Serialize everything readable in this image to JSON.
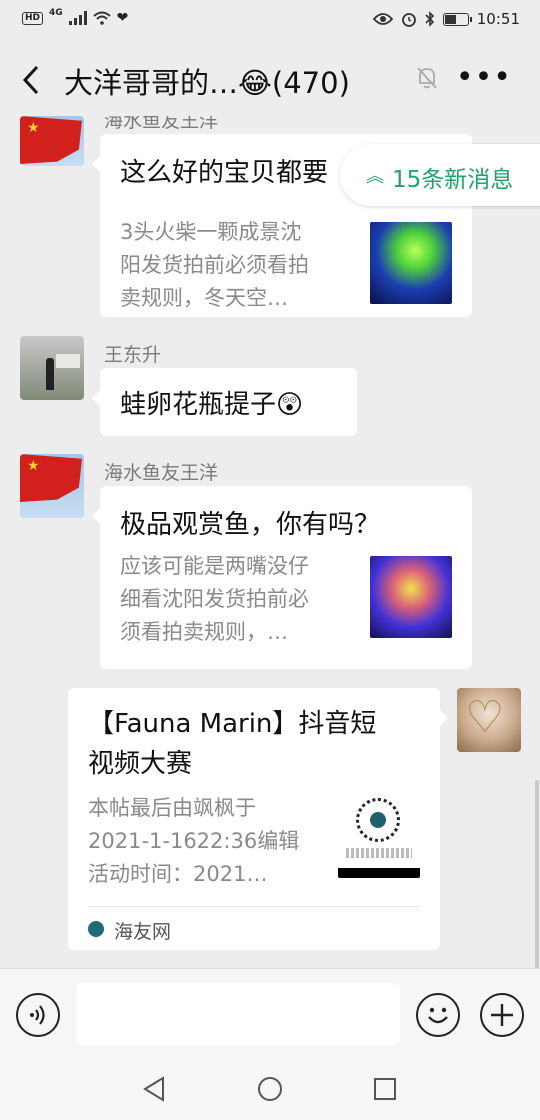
{
  "status_bar": {
    "hd": "HD",
    "network": "4G",
    "time": "10:51",
    "battery_level": 0.5
  },
  "header": {
    "title": "大洋哥哥的…",
    "title_emoji": "😂",
    "count": "(470)",
    "icons": [
      "back-arrow-icon",
      "mute-bell-icon",
      "more-icon"
    ]
  },
  "new_messages": {
    "label": "15条新消息"
  },
  "messages": [
    {
      "sender": "海水鱼友王洋",
      "type": "card",
      "title": "这么好的宝贝都要",
      "desc_lines": [
        "3头火柴一颗成景沈",
        "阳发货拍前必须看拍",
        "卖规则，冬天空…"
      ]
    },
    {
      "sender": "王东升",
      "type": "text",
      "text": "蛙卵花瓶提子",
      "emoji": "😲"
    },
    {
      "sender": "海水鱼友王洋",
      "type": "card",
      "title": "极品观赏鱼，你有吗？",
      "desc_lines": [
        "应该可能是两嘴没仔",
        "细看沈阳发货拍前必",
        "须看拍卖规则，…"
      ]
    },
    {
      "sender": "",
      "type": "article",
      "title_lines": [
        "【Fauna Marin】抖音短",
        "视频大赛"
      ],
      "desc_lines": [
        "本帖最后由飒枫于",
        "2021-1-1622:36编辑",
        "活动时间：2021…"
      ],
      "source": "海友网"
    }
  ],
  "input_bar": {
    "placeholder": "",
    "icons": [
      "voice-icon",
      "emoji-icon",
      "add-icon"
    ]
  },
  "nav_bar": {
    "icons": [
      "back-triangle-icon",
      "home-circle-icon",
      "recents-square-icon"
    ]
  }
}
